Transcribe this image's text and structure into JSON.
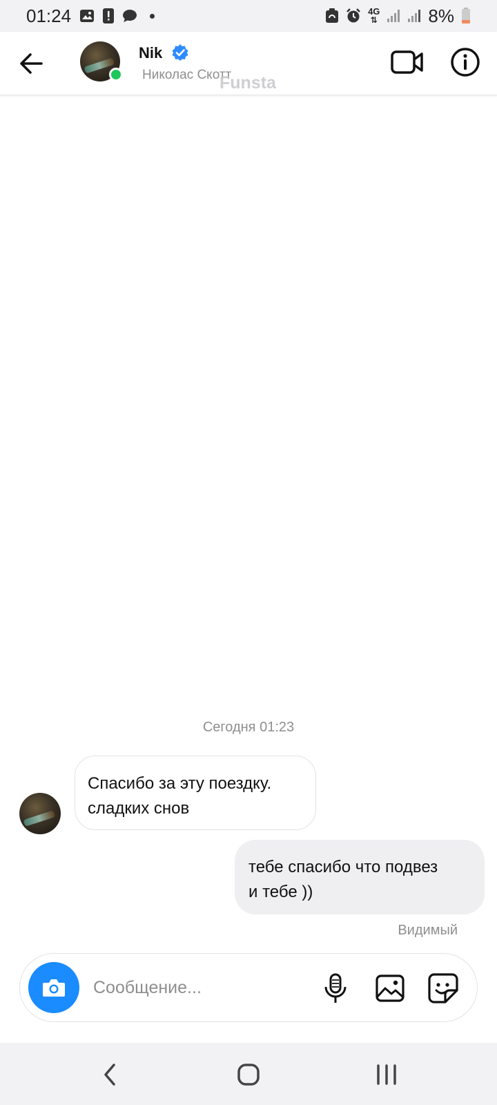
{
  "status_bar": {
    "time": "01:24",
    "battery": "8%",
    "network": "4G",
    "icons": [
      "gallery-icon",
      "alert-icon",
      "chat-icon",
      "dot-icon",
      "recycle-icon",
      "alarm-icon",
      "network-4g-icon",
      "signal-icon",
      "signal-icon",
      "battery-low-icon"
    ]
  },
  "header": {
    "name": "Nik",
    "subtitle": "Николас Скотт",
    "watermark": "Funsta",
    "online_color": "#1cc75b",
    "verified_color": "#2f8cff"
  },
  "conversation": {
    "date_label": "Сегодня 01:23",
    "incoming": {
      "line1": "Спасибо за эту поездку.",
      "line2": "сладких снов"
    },
    "outgoing": {
      "line1": "тебе спасибо что подвез",
      "line2": "и тебе ))"
    },
    "seen": "Видимый"
  },
  "composer": {
    "placeholder": "Сообщение...",
    "camera_color": "#1a8cff"
  }
}
